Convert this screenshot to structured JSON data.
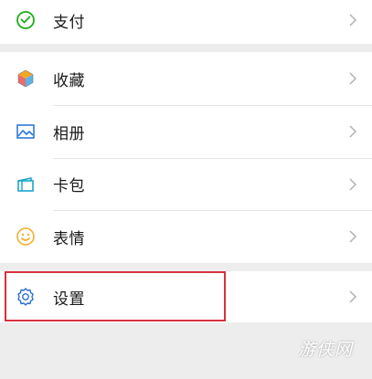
{
  "menu": {
    "pay": {
      "label": "支付",
      "icon": "wechat-pay-icon"
    },
    "favorites": {
      "label": "收藏",
      "icon": "cube-icon"
    },
    "album": {
      "label": "相册",
      "icon": "picture-icon"
    },
    "cards": {
      "label": "卡包",
      "icon": "card-wallet-icon"
    },
    "stickers": {
      "label": "表情",
      "icon": "smiley-icon"
    },
    "settings": {
      "label": "设置",
      "icon": "gear-icon"
    }
  },
  "watermark": {
    "text": "游侠网"
  },
  "colors": {
    "pay_green": "#1aad19",
    "favorites_orange": "#f5a623",
    "album_blue": "#2b7ad8",
    "cards_teal": "#1aa5c8",
    "stickers_yellow": "#f0b02a",
    "settings_blue": "#2c6fd2",
    "highlight_red": "#d6313e",
    "background": "#ededed"
  }
}
